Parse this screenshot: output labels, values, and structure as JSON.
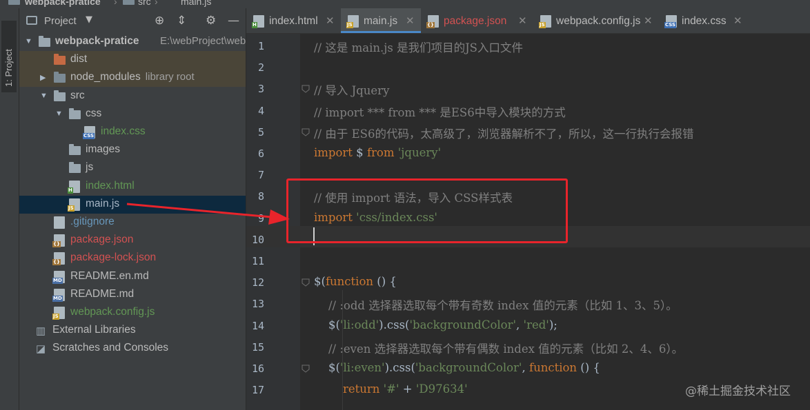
{
  "breadcrumb": [
    "webpack-pratice",
    "src",
    "main.js"
  ],
  "tool_stripe": {
    "label": "1: Project"
  },
  "project_panel": {
    "title": "Project",
    "tree": [
      {
        "label": "webpack-pratice",
        "suffix": "E:\\webProject\\webp",
        "type": "folder",
        "expanded": true,
        "color": "#bbbbbb"
      },
      {
        "label": "dist",
        "type": "folder",
        "color": "#bbbbbb"
      },
      {
        "label": "node_modules",
        "suffix": "library root",
        "type": "folder",
        "color": "#bbbbbb"
      },
      {
        "label": "src",
        "type": "folder",
        "expanded": true,
        "color": "#bbbbbb"
      },
      {
        "label": "css",
        "type": "folder",
        "expanded": true,
        "color": "#bbbbbb"
      },
      {
        "label": "index.css",
        "type": "file",
        "icon": "CSS",
        "color": "#629755"
      },
      {
        "label": "images",
        "type": "folder",
        "color": "#bbbbbb"
      },
      {
        "label": "js",
        "type": "folder",
        "color": "#bbbbbb"
      },
      {
        "label": "index.html",
        "type": "file",
        "icon": "H",
        "color": "#629755"
      },
      {
        "label": "main.js",
        "type": "file",
        "icon": "JS",
        "color": "#a9b7c6",
        "selected": true
      },
      {
        "label": ".gitignore",
        "type": "file",
        "icon": "",
        "color": "#6897bb"
      },
      {
        "label": "package.json",
        "type": "file",
        "icon": "{}",
        "color": "#d25252"
      },
      {
        "label": "package-lock.json",
        "type": "file",
        "icon": "{}",
        "color": "#d25252"
      },
      {
        "label": "README.en.md",
        "type": "file",
        "icon": "MD",
        "color": "#bbbbbb"
      },
      {
        "label": "README.md",
        "type": "file",
        "icon": "MD",
        "color": "#bbbbbb"
      },
      {
        "label": "webpack.config.js",
        "type": "file",
        "icon": "JS",
        "color": "#629755"
      },
      {
        "label": "External Libraries",
        "type": "lib",
        "color": "#bbbbbb"
      },
      {
        "label": "Scratches and Consoles",
        "type": "scratch",
        "color": "#bbbbbb"
      }
    ]
  },
  "tabs": [
    {
      "label": "index.html",
      "icon": "H",
      "color": "#bbbbbb"
    },
    {
      "label": "main.js",
      "icon": "JS",
      "color": "#bbbbbb",
      "active": true
    },
    {
      "label": "package.json",
      "icon": "{}",
      "color": "#d25252"
    },
    {
      "label": "webpack.config.js",
      "icon": "JS",
      "color": "#bbbbbb"
    },
    {
      "label": "index.css",
      "icon": "CSS",
      "color": "#bbbbbb"
    }
  ],
  "code_lines": [
    {
      "n": "1",
      "parts": [
        {
          "t": "// 这是 main.js 是我们项目的JS入口文件",
          "c": "cm"
        }
      ]
    },
    {
      "n": "2",
      "parts": []
    },
    {
      "n": "3",
      "parts": [
        {
          "t": "// 导入 Jquery",
          "c": "cm"
        }
      ]
    },
    {
      "n": "4",
      "parts": [
        {
          "t": "// import *** from *** 是ES6中导入模块的方式",
          "c": "cm"
        }
      ]
    },
    {
      "n": "5",
      "parts": [
        {
          "t": "// 由于 ES6的代码，太高级了，浏览器解析不了，所以，这一行执行会报错",
          "c": "cm"
        }
      ]
    },
    {
      "n": "6",
      "parts": [
        {
          "t": "import",
          "c": "kw"
        },
        {
          "t": " $ ",
          "c": "df"
        },
        {
          "t": "from",
          "c": "kw"
        },
        {
          "t": " 'jquery'",
          "c": "st"
        }
      ]
    },
    {
      "n": "7",
      "parts": []
    },
    {
      "n": "8",
      "parts": [
        {
          "t": "// 使用 import 语法，导入 CSS样式表",
          "c": "cm"
        }
      ]
    },
    {
      "n": "9",
      "parts": [
        {
          "t": "import",
          "c": "kw"
        },
        {
          "t": " 'css/index.css'",
          "c": "st"
        }
      ]
    },
    {
      "n": "10",
      "parts": []
    },
    {
      "n": "11",
      "parts": []
    },
    {
      "n": "12",
      "parts": [
        {
          "t": "$(",
          "c": "df"
        },
        {
          "t": "function",
          "c": "kw"
        },
        {
          "t": " () {",
          "c": "df"
        }
      ]
    },
    {
      "n": "13",
      "parts": [
        {
          "t": "    // :odd 选择器选取每个带有奇数 index 值的元素（比如 1、3、5）。",
          "c": "cm"
        }
      ]
    },
    {
      "n": "14",
      "parts": [
        {
          "t": "    $(",
          "c": "df"
        },
        {
          "t": "'li:odd'",
          "c": "st"
        },
        {
          "t": ").css(",
          "c": "df"
        },
        {
          "t": "'backgroundColor'",
          "c": "st"
        },
        {
          "t": ", ",
          "c": "df"
        },
        {
          "t": "'red'",
          "c": "st"
        },
        {
          "t": ");",
          "c": "df"
        }
      ]
    },
    {
      "n": "15",
      "parts": [
        {
          "t": "    // :even 选择器选取每个带有偶数 index 值的元素（比如 2、4、6）。",
          "c": "cm"
        }
      ]
    },
    {
      "n": "16",
      "parts": [
        {
          "t": "    $(",
          "c": "df"
        },
        {
          "t": "'li:even'",
          "c": "st"
        },
        {
          "t": ").css(",
          "c": "df"
        },
        {
          "t": "'backgroundColor'",
          "c": "st"
        },
        {
          "t": ", ",
          "c": "df"
        },
        {
          "t": "function",
          "c": "kw"
        },
        {
          "t": " () {",
          "c": "df"
        }
      ]
    },
    {
      "n": "17",
      "parts": [
        {
          "t": "        ",
          "c": "df"
        },
        {
          "t": "return",
          "c": "kw"
        },
        {
          "t": " '#' ",
          "c": "st"
        },
        {
          "t": "+",
          "c": "df"
        },
        {
          "t": " 'D97634'",
          "c": "st"
        }
      ]
    }
  ],
  "watermark": "@稀土掘金技术社区",
  "colors": {
    "accent": "#4a88c7",
    "annotation": "#e8242b",
    "selection": "#0d293e"
  }
}
